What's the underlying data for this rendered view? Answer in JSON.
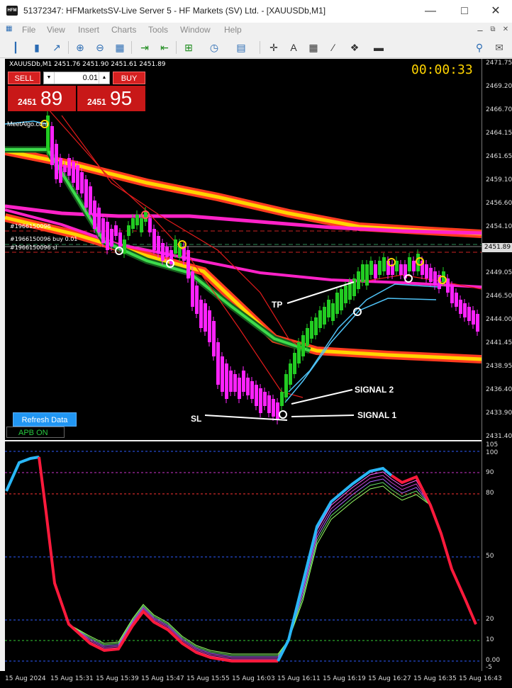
{
  "window": {
    "title": "51372347: HFMarketsSV-Live Server 5 - HF Markets (SV) Ltd. - [XAUUSDb,M1]",
    "app_icon_text": "HFM"
  },
  "menu": [
    "File",
    "View",
    "Insert",
    "Charts",
    "Tools",
    "Window",
    "Help"
  ],
  "symbol_info": "XAUUSDb,M1  2451.76 2451.90 2451.61 2451.89",
  "one_click": {
    "sell_label": "SELL",
    "buy_label": "BUY",
    "lot": "0.01",
    "bid_prefix": "2451",
    "bid_big": "89",
    "ask_prefix": "2451",
    "ask_big": "95"
  },
  "timer": "00:00:33",
  "brand": "MeetAlgo.com",
  "orders": {
    "tp_line": "#1966150096",
    "entry_line": "#1966150096 buy 0.01",
    "sl_line": "#1966150096 sl"
  },
  "annotations": {
    "tp": "TP",
    "sl": "SL",
    "signal1": "SIGNAL 1",
    "signal2": "SIGNAL 2"
  },
  "buttons": {
    "refresh": "Refresh Data",
    "apb": "APB ON"
  },
  "price_axis": [
    "2471.75",
    "2469.20",
    "2466.70",
    "2464.15",
    "2461.65",
    "2459.10",
    "2456.60",
    "2454.10",
    "2451.89",
    "2449.05",
    "2446.50",
    "2444.00",
    "2441.45",
    "2438.95",
    "2436.40",
    "2433.90",
    "2431.40"
  ],
  "current_price": "2451.89",
  "osc_axis": [
    "105",
    "100",
    "90",
    "80",
    "50",
    "20",
    "10",
    "0.00",
    "-5"
  ],
  "time_axis": [
    "15 Aug 2024",
    "15 Aug 15:31",
    "15 Aug 15:39",
    "15 Aug 15:47",
    "15 Aug 15:55",
    "15 Aug 16:03",
    "15 Aug 16:11",
    "15 Aug 16:19",
    "15 Aug 16:27",
    "15 Aug 16:35",
    "15 Aug 16:43"
  ],
  "colors": {
    "bull": "#22cc22",
    "bear": "#ff22ff",
    "yellow_band": "#ffd400",
    "magenta_band": "#ff22c8",
    "osc_up": "#29b6f6",
    "osc_down": "#ff1a3c",
    "refresh_btn": "#2196f3",
    "apb_text": "#28c840"
  }
}
